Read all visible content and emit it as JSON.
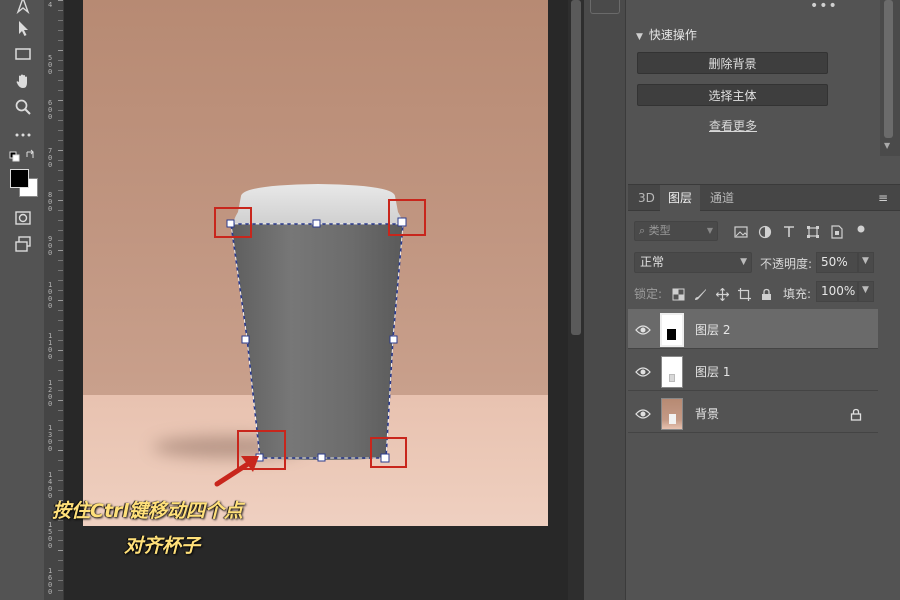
{
  "toolbar": {
    "tools": [
      {
        "icon": "pen-icon"
      },
      {
        "icon": "path-select-icon"
      },
      {
        "icon": "rectangle-icon"
      },
      {
        "icon": "hand-icon"
      },
      {
        "icon": "zoom-icon"
      },
      {
        "icon": "more-tools-icon"
      },
      {
        "icon": "swap-colors-icon"
      },
      {
        "icon": "color-swatches-icon"
      },
      {
        "icon": "quick-mask-icon"
      },
      {
        "icon": "screen-mode-icon"
      }
    ],
    "foreground_color": "#000000",
    "background_color": "#ffffff"
  },
  "ruler": {
    "labels": [
      "4",
      "5 0 0",
      "6 0 0",
      "7 0 0",
      "8 0 0",
      "9 0 0",
      "1 0 0 0",
      "1 1 0 0",
      "1 2 0 0",
      "1 3 0 0",
      "1 4 0 0",
      "1 5 0 0",
      "1 6 0 0"
    ]
  },
  "canvas": {
    "annotation_line1": "按住Ctrl键移动四个点",
    "annotation_line2": "对齐杯子",
    "annotation_color": "#ffe07a",
    "highlight_color": "#c8261c"
  },
  "quick_actions": {
    "more_dots": "•••",
    "title": "快速操作",
    "remove_background": "删除背景",
    "select_subject": "选择主体",
    "see_more": "查看更多"
  },
  "layers_panel": {
    "tabs": [
      "3D",
      "图层",
      "通道"
    ],
    "active_tab": "图层",
    "filter_placeholder": "类型",
    "blend_mode": "正常",
    "opacity_label": "不透明度:",
    "opacity_value": "50%",
    "lock_label": "锁定:",
    "fill_label": "填充:",
    "fill_value": "100%",
    "layers": [
      {
        "name": "图层 2",
        "selected": true,
        "locked": false
      },
      {
        "name": "图层 1",
        "selected": false,
        "locked": false
      },
      {
        "name": "背景",
        "selected": false,
        "locked": true
      }
    ]
  }
}
